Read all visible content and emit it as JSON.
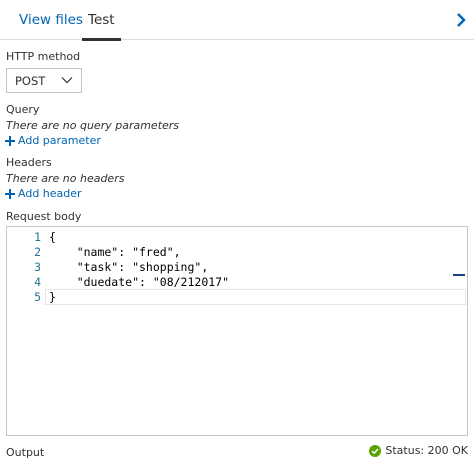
{
  "tabs": {
    "view_files": "View files",
    "test": "Test",
    "active": "Test"
  },
  "http_method": {
    "label": "HTTP method",
    "selected": "POST"
  },
  "query": {
    "label": "Query",
    "empty_text": "There are no query parameters",
    "add_label": "Add parameter"
  },
  "headers": {
    "label": "Headers",
    "empty_text": "There are no headers",
    "add_label": "Add header"
  },
  "request_body": {
    "label": "Request body",
    "lines": [
      {
        "num": "1",
        "text": "{"
      },
      {
        "num": "2",
        "text": "    \"name\": \"fred\","
      },
      {
        "num": "3",
        "text": "    \"task\": \"shopping\","
      },
      {
        "num": "4",
        "text": "    \"duedate\": \"08/212017\""
      },
      {
        "num": "5",
        "text": "}"
      }
    ]
  },
  "output": {
    "label": "Output",
    "status": "Status: 200 OK"
  },
  "colors": {
    "accent": "#0063b1",
    "status_ok": "#57a300",
    "line_number": "#237893"
  },
  "icons": {
    "collapse": "chevron-right-icon",
    "dropdown": "chevron-down-icon",
    "add": "plus-icon",
    "status": "check-circle-icon"
  }
}
